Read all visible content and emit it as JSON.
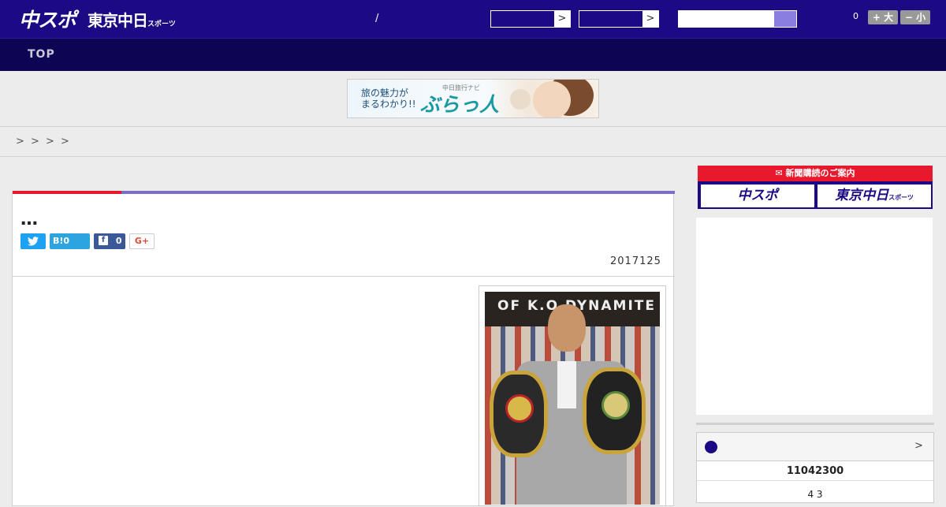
{
  "header": {
    "logo_chuspo": "中スポ",
    "logo_tokyo": "東京中日",
    "logo_tokyo_sub": "スポーツ",
    "slash": "/",
    "select_arrow": ">",
    "count": "0",
    "font_larger": "+ 大",
    "font_smaller": "− 小",
    "colors": {
      "primary": "#1b0a84",
      "nav": "#0e0454",
      "accent": "#8a7fe0"
    }
  },
  "nav": {
    "items": [
      "TOP"
    ]
  },
  "banner": {
    "line1": "旅の魅力が",
    "line2": "まるわかり!!",
    "brand_small": "中日旅行ナビ",
    "brand": "ぶらっ人"
  },
  "breadcrumb": {
    "separators": [
      ">",
      ">",
      ">",
      ">"
    ]
  },
  "article": {
    "title": "…",
    "social": {
      "tweet_icon": "twitter-icon",
      "hatena": "B!0",
      "fb_count": "0",
      "gplus": "G+"
    },
    "date": "2017125",
    "accent_colors": {
      "red": "#e8192c",
      "purple": "#7b6fc4"
    },
    "photo_sign": "OF K.O DYNAMITE"
  },
  "sidebar": {
    "subscribe_label": "新聞購読のご案内",
    "sub_btn1": "中スポ",
    "sub_btn2": "東京中日",
    "sub_btn2_sub": "スポーツ",
    "box": {
      "more": ">",
      "row1": "11042300",
      "row2": "4  3"
    }
  }
}
